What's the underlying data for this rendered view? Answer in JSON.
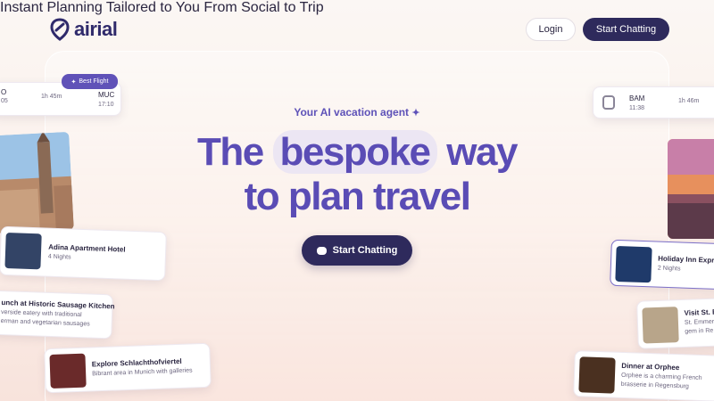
{
  "header": {
    "logo_text": "airial",
    "nav": [
      "Instant Planning",
      "Tailored to You",
      "From Social to Trip"
    ],
    "login_label": "Login",
    "start_label": "Start Chatting"
  },
  "hero": {
    "tagline": "Your AI vacation agent",
    "headline_word1": "The",
    "headline_highlight": "bespoke",
    "headline_word2": "way",
    "headline_line2": "to plan travel",
    "cta_label": "Start Chatting"
  },
  "cards": {
    "flight_left": {
      "badge": "Best Flight",
      "from_code": "O",
      "from_time": "05",
      "duration": "1h 45m",
      "to_code": "MUC",
      "to_time": "17:10"
    },
    "hotel_left": {
      "name": "Adina Apartment Hotel",
      "nights": "4 Nights"
    },
    "lunch_left": {
      "title": "unch at Historic Sausage Kitchen",
      "line1": "verside eatery with traditional",
      "line2": "erman and vegetarian sausages"
    },
    "explore_left": {
      "title": "Explore Schlachthofviertel",
      "line1": "Bibrant area in Munich with galleries"
    },
    "train_right": {
      "code": "BAM",
      "time": "11:38",
      "duration": "1h 46m"
    },
    "hotel_right": {
      "name": "Holiday Inn Expres",
      "nights": "2 Nights"
    },
    "visit_right": {
      "title": "Visit St. E",
      "line1": "St. Emmer",
      "line2": "gem in Re"
    },
    "dinner_right": {
      "title": "Dinner at Orphee",
      "line1": "Orphee is a charming French",
      "line2": "brasserie in Regensburg"
    }
  },
  "colors": {
    "brand": "#2e2a5c",
    "accent": "#5a4cb5",
    "background": "#fbf1ec"
  }
}
